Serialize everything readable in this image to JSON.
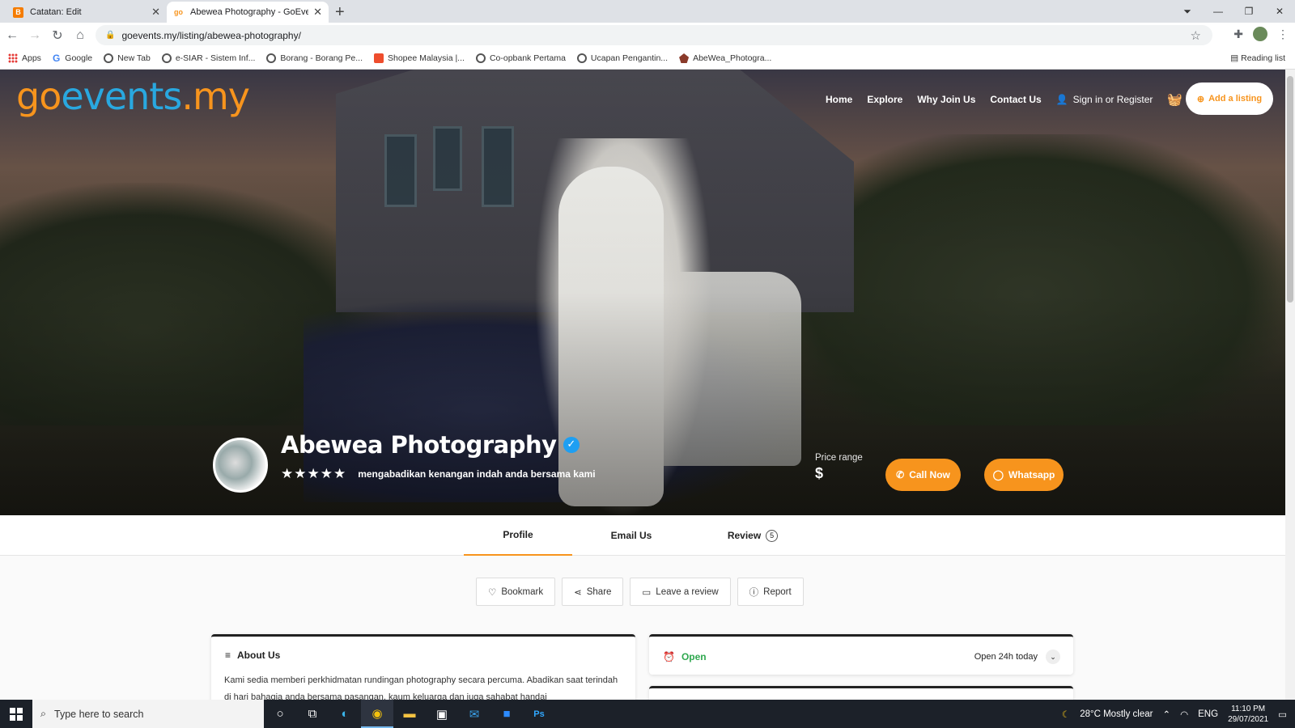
{
  "browser": {
    "tabs": [
      {
        "title": "Catatan: Edit",
        "active": false,
        "favicon_color": "#f57c00",
        "favicon_text": "B"
      },
      {
        "title": "Abewea Photography - GoEvents",
        "active": true,
        "favicon_color": "#f7941d",
        "favicon_text": "go"
      }
    ],
    "new_tab_icon": "+",
    "url": "goevents.my/listing/abewea-photography/",
    "bookmarks": [
      "Apps",
      "Google",
      "New Tab",
      "e-SIAR - Sistem Inf...",
      "Borang - Borang Pe...",
      "Shopee Malaysia |...",
      "Co-opbank Pertama",
      "Ucapan Pengantin...",
      "AbeWea_Photogra..."
    ],
    "reading_list": "Reading list"
  },
  "site": {
    "logo": {
      "go": "go",
      "events": "events",
      "my": ".my"
    },
    "nav": [
      "Home",
      "Explore",
      "Why Join Us",
      "Contact Us"
    ],
    "signin": "Sign in or Register",
    "add_listing": "Add a listing",
    "brand_color": "#f7941d",
    "brand_blue": "#29a8e0"
  },
  "listing": {
    "name": "Abewea Photography",
    "verified": true,
    "stars": "★★★★★",
    "tagline": "mengabadikan kenangan indah anda bersama kami",
    "price_label": "Price range",
    "price_value": "$",
    "call_label": "Call Now",
    "whatsapp_label": "Whatsapp"
  },
  "profile_tabs": [
    {
      "label": "Profile",
      "active": true
    },
    {
      "label": "Email Us",
      "active": false
    },
    {
      "label": "Review",
      "active": false,
      "count": "5"
    }
  ],
  "actions": [
    "Bookmark",
    "Share",
    "Leave a review",
    "Report"
  ],
  "about": {
    "title": "About Us",
    "text": "Kami sedia memberi perkhidmatan rundingan photography secara percuma. Abadikan saat terindah di hari bahagia anda bersama pasangan, kaum keluarga dan juga sahabat handai"
  },
  "hours": {
    "status": "Open",
    "summary": "Open 24h today",
    "status_color": "#2fa84f"
  },
  "taskbar": {
    "search_placeholder": "Type here to search",
    "weather": "28°C  Mostly clear",
    "lang": "ENG",
    "time": "11:10 PM",
    "date": "29/07/2021"
  }
}
